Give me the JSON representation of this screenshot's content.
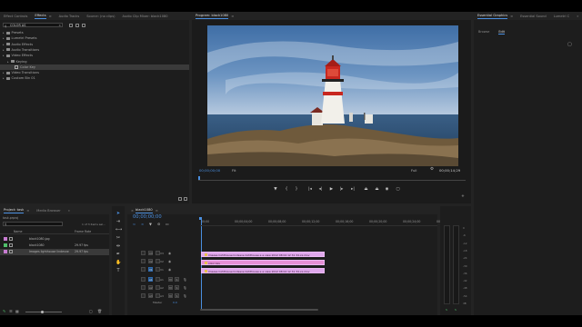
{
  "source_panel": {
    "tabs": [
      "Effect Controls",
      "Effects",
      "Audio Tracks",
      "Source: (no clips)",
      "Audio Clip Mixer: black1080"
    ],
    "active_tab": 1,
    "search_value": "COLOR AS",
    "tree": [
      {
        "label": "Presets",
        "type": "folder",
        "indent": 0
      },
      {
        "label": "Lumetri Presets",
        "type": "folder",
        "indent": 0
      },
      {
        "label": "Audio Effects",
        "type": "folder",
        "indent": 0
      },
      {
        "label": "Audio Transitions",
        "type": "folder",
        "indent": 0
      },
      {
        "label": "Video Effects",
        "type": "folder",
        "indent": 0
      },
      {
        "label": "Keying",
        "type": "folder",
        "indent": 1
      },
      {
        "label": "Color Key",
        "type": "effect",
        "indent": 2,
        "selected": true
      },
      {
        "label": "Video Transitions",
        "type": "folder",
        "indent": 0
      },
      {
        "label": "Custom Bin 01",
        "type": "folder",
        "indent": 0
      }
    ]
  },
  "program_monitor": {
    "title": "Program: black1080",
    "timecode_left": "00;00;00;00",
    "fit_label": "Fit",
    "quality_label": "Full",
    "timecode_right": "00;00;14;29"
  },
  "graphics_panel": {
    "tabs": [
      "Essential Graphics",
      "Essential Sound",
      "Lumetri C"
    ],
    "subtabs": [
      "Browse",
      "Edit"
    ],
    "active_subtab": 1
  },
  "project_panel": {
    "tabs": [
      "Project: task",
      "Media Browser"
    ],
    "project_file": "task.prproj",
    "items_count": "1 of 3 items sel...",
    "columns": [
      "Name",
      "Frame Rate"
    ],
    "items": [
      {
        "name": "black1080.jpg",
        "rate": "",
        "color": "#c77bd1"
      },
      {
        "name": "black1080",
        "rate": "29.97 fps",
        "color": "#4fbf6a"
      },
      {
        "name": "Images lighthouse lindesne",
        "rate": "29.97 fps",
        "color": "#c77bd1",
        "selected": true
      }
    ]
  },
  "timeline": {
    "sequence_name": "black1080",
    "timecode": "00;00;00;00",
    "ruler": [
      "00;00",
      "00;00;04;00",
      "00;00;08;00",
      "00;00;12;00",
      "00;00;16;00",
      "00;00;20;00",
      "00;00;24;00",
      "00;00;28;00"
    ],
    "video_tracks": [
      "V3",
      "V2",
      "V1"
    ],
    "audio_tracks": [
      "A1",
      "A2",
      "A3"
    ],
    "master_label": "Master",
    "master_value": "0.0",
    "clips": [
      {
        "label": "Images lighthouse lindesne lighthouse e a view 2012 08 04 12 31 34.xx.mov",
        "track": "V3",
        "color": "#e0a8ec"
      },
      {
        "label": "color key",
        "track": "V2",
        "color": "#e58fd5"
      },
      {
        "label": "Images lighthouse lindesne lighthouse e a view 2012 08 04 12 31 34.xx.mov",
        "track": "V1",
        "color": "#e0a8ec"
      }
    ]
  },
  "audio_meter": {
    "scale": [
      "0",
      "-6",
      "-12",
      "-18",
      "-24",
      "-30",
      "-36",
      "-42",
      "-48",
      "-54",
      "dB"
    ],
    "channels": [
      "S",
      "S"
    ]
  }
}
